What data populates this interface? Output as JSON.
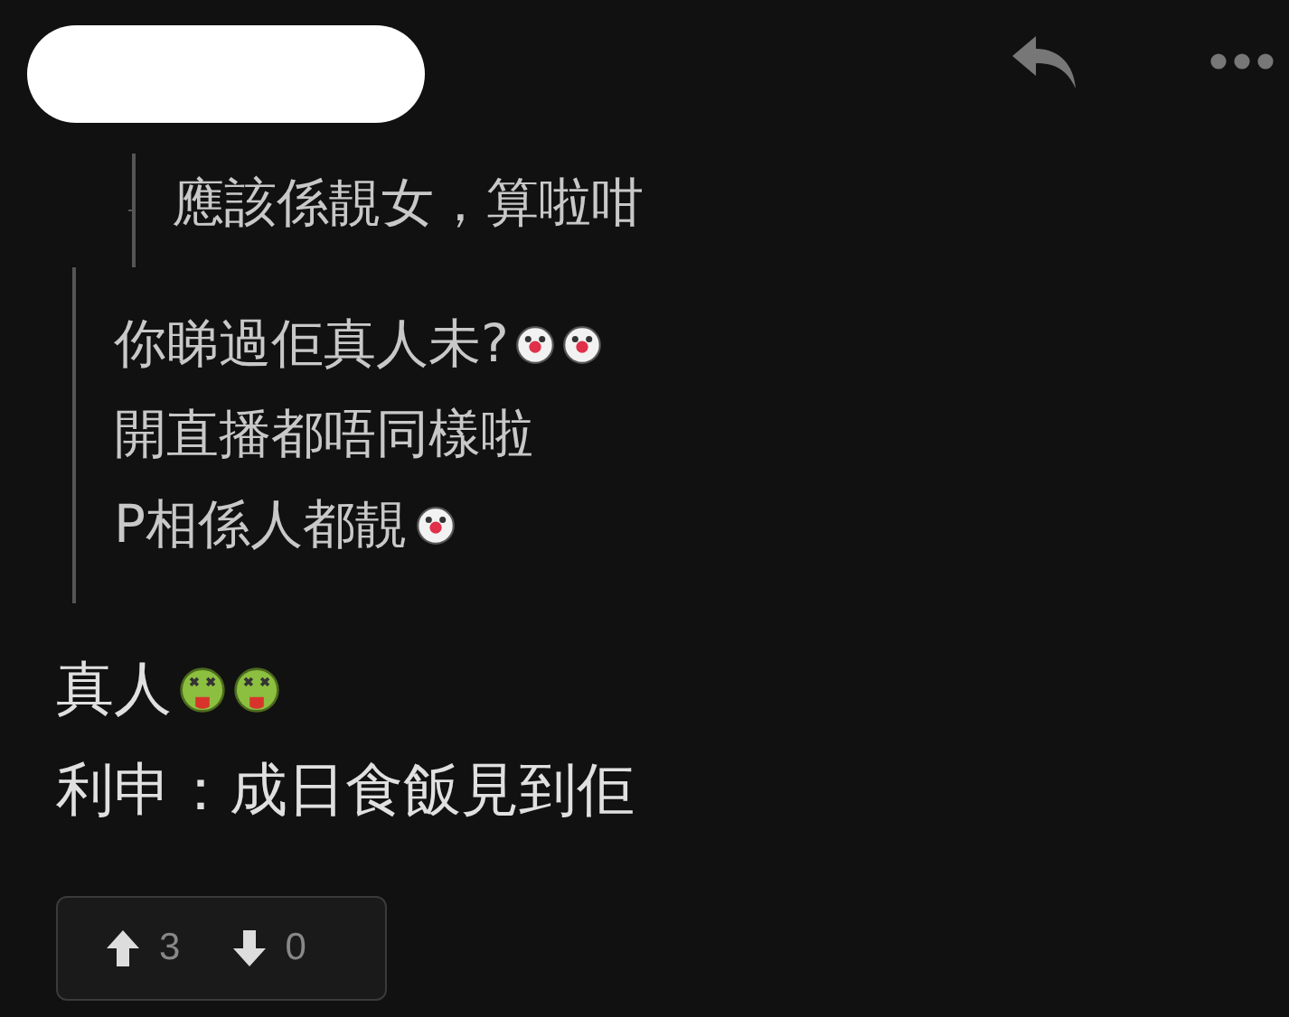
{
  "post": {
    "author_hidden": true,
    "actions": [
      {
        "kind": "reply"
      },
      {
        "kind": "more"
      }
    ]
  },
  "quote": {
    "nested_quote": {
      "lines": [
        {
          "text": "應該係靚女，算啦咁"
        }
      ]
    },
    "lines": [
      {
        "text": "你睇過佢真人未?",
        "emojis": [
          {
            "kind": "clown"
          },
          {
            "kind": "clown"
          }
        ]
      },
      {
        "text": "開直播都唔同樣啦"
      },
      {
        "text": "P相係人都靚",
        "emojis": [
          {
            "kind": "clown"
          }
        ]
      }
    ]
  },
  "body": [
    {
      "text": "真人",
      "emojis": [
        {
          "kind": "sick"
        },
        {
          "kind": "sick"
        }
      ]
    },
    {
      "text": "利申：成日食飯見到佢"
    }
  ],
  "votes": {
    "up": "3",
    "down": "0"
  }
}
